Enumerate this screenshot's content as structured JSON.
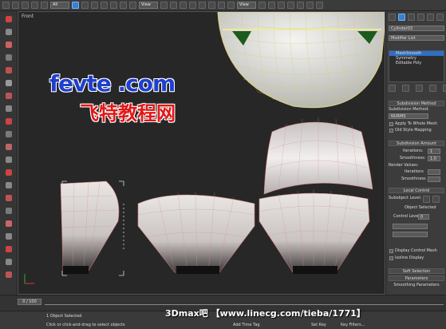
{
  "toolbar": {
    "filter_select": "All",
    "view_select": "View",
    "view_select_2": "View"
  },
  "viewport": {
    "label": "Front"
  },
  "command_panel": {
    "object_name": "Cylinder03",
    "modifier_list": "Modifier List",
    "stack": [
      "MeshSmooth",
      "Symmetry",
      "Editable Poly"
    ],
    "rollouts": {
      "subdivision_method": "Subdivision Method",
      "subdivision_method_label": "Subdivision Method:",
      "method_value": "NURMS",
      "apply_to_whole_mesh": "Apply To Whole Mesh",
      "old_style_mapping": "Old Style Mapping",
      "subdivision_amount": "Subdivision Amount",
      "iterations_label": "Iterations:",
      "iterations_value": "1",
      "smoothness_label": "Smoothness:",
      "smoothness_value": "1.0",
      "render_values": "Render Values:",
      "render_iterations_label": "Iterations",
      "render_smoothness_label": "Smoothness",
      "local_control": "Local Control",
      "subobject_level_label": "Subobject Level:",
      "object_selected": "Object Selected",
      "control_level_label": "Control Level:",
      "control_level_value": "0",
      "display_control_mesh": "Display Control Mesh",
      "isoline_display": "Isoline Display",
      "soft_selection": "Soft Selection",
      "parameters": "Parameters",
      "smoothing_parameters": "Smoothing Parameters"
    }
  },
  "timeline": {
    "frame": "0 / 100"
  },
  "status": {
    "selected": "1 Object Selected",
    "hint": "Click or click-and-drag to select objects",
    "add_time_tag": "Add Time Tag",
    "set_key": "Set Key",
    "key_filters": "Key Filters..."
  },
  "watermarks": {
    "brand": "fevte .com",
    "brand_cn": "飞特教程网",
    "credit": "3Dmax吧 【www.linecg.com/tieba/1771】"
  },
  "colors": {
    "accent": "#3a7fd0",
    "selected_row": "#2f6fc4",
    "viewport_bg": "#272727",
    "panel_bg": "#3c3c3c"
  }
}
